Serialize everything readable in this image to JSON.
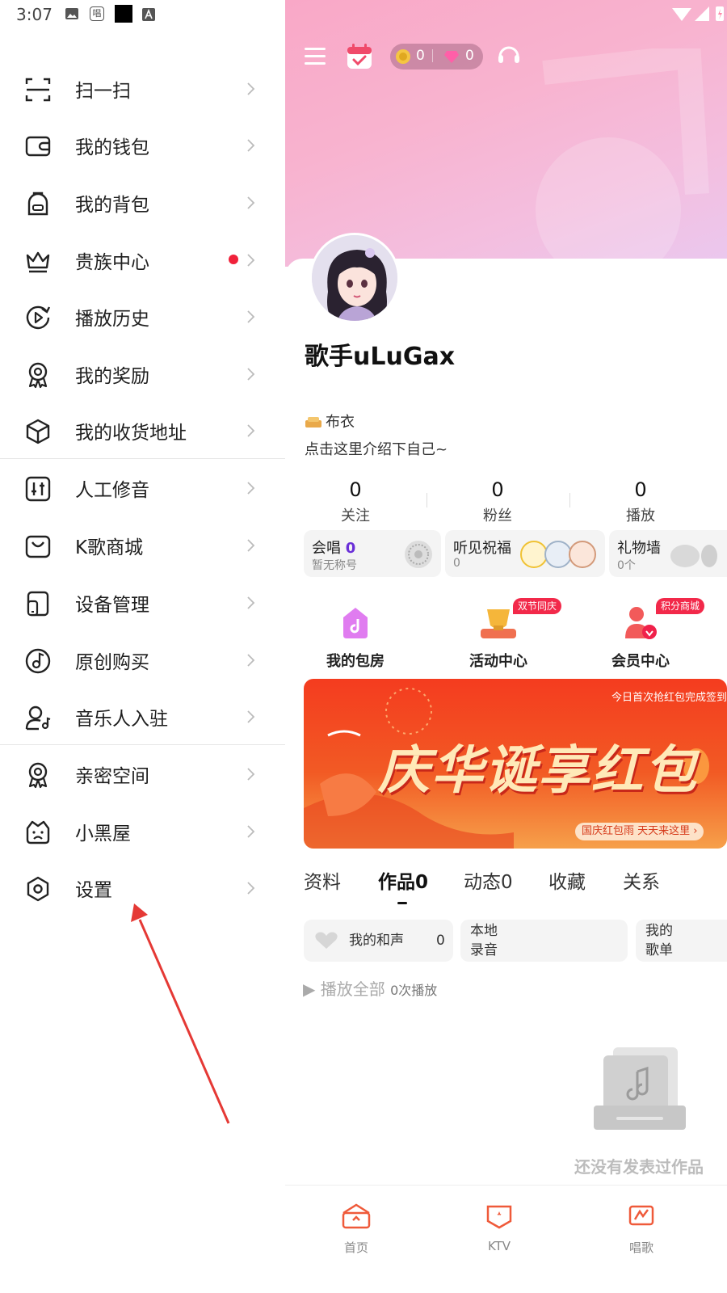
{
  "status_bar": {
    "time": "3:07",
    "notif_app_text": "唱"
  },
  "drawer": {
    "group1": [
      {
        "label": "扫一扫",
        "icon": "scan-icon"
      },
      {
        "label": "我的钱包",
        "icon": "wallet-icon"
      },
      {
        "label": "我的背包",
        "icon": "backpack-icon"
      },
      {
        "label": "贵族中心",
        "icon": "crown-icon",
        "red_dot": true
      },
      {
        "label": "播放历史",
        "icon": "history-icon"
      },
      {
        "label": "我的奖励",
        "icon": "reward-medal-icon"
      },
      {
        "label": "我的收货地址",
        "icon": "box-icon"
      }
    ],
    "group2": [
      {
        "label": "人工修音",
        "icon": "equalizer-icon"
      },
      {
        "label": "K歌商城",
        "icon": "shop-bag-icon"
      },
      {
        "label": "设备管理",
        "icon": "device-icon"
      },
      {
        "label": "原创购买",
        "icon": "music-disc-icon"
      },
      {
        "label": "音乐人入驻",
        "icon": "musician-icon"
      }
    ],
    "group3": [
      {
        "label": "亲密空间",
        "icon": "intimacy-medal-icon"
      },
      {
        "label": "小黑屋",
        "icon": "sad-face-icon"
      },
      {
        "label": "设置",
        "icon": "settings-icon"
      }
    ]
  },
  "profile": {
    "coins": "0",
    "diamonds": "0",
    "username": "歌手uLuGax",
    "rank": "布衣",
    "bio": "点击这里介绍下自己~",
    "stats": [
      {
        "num": "0",
        "label": "关注"
      },
      {
        "num": "0",
        "label": "粉丝"
      },
      {
        "num": "0",
        "label": "播放"
      }
    ],
    "mini_cards": {
      "hechang": {
        "title": "会唱",
        "count": "0",
        "sub": "暂无称号"
      },
      "blessing": {
        "title": "听见祝福",
        "sub": "0"
      },
      "gift_wall": {
        "title": "礼物墙",
        "sub": "0个"
      }
    },
    "features": [
      {
        "label": "我的包房",
        "badge": ""
      },
      {
        "label": "活动中心",
        "badge": "双节同庆"
      },
      {
        "label": "会员中心",
        "badge": "积分商城"
      }
    ],
    "banner": {
      "top_text": "今日首次抢红包完成签到",
      "main_text": "庆华诞享红包",
      "tag_text": "国庆红包雨 天天来这里 ›"
    },
    "tabs": [
      "资料",
      "作品0",
      "动态0",
      "收藏",
      "关系"
    ],
    "active_tab": "作品0",
    "sub_tabs": {
      "harmony": {
        "label": "我的和声",
        "count": "0"
      },
      "local": {
        "line1": "本地",
        "line2": "录音"
      },
      "songlist": {
        "line1": "我的",
        "line2": "歌单"
      }
    },
    "play_all": {
      "label": "▶ 播放全部",
      "count": "0次播放"
    },
    "empty_text": "还没有发表过作品"
  },
  "bottom_nav": [
    {
      "label": "首页",
      "icon": "home-icon"
    },
    {
      "label": "KTV",
      "icon": "ktv-icon"
    },
    {
      "label": "唱歌",
      "icon": "sing-icon"
    }
  ],
  "colors": {
    "accent": "#f0213a",
    "brand_orange": "#f25a24",
    "purple": "#6a2fd8",
    "pink_bg": "#f9a8c7"
  }
}
